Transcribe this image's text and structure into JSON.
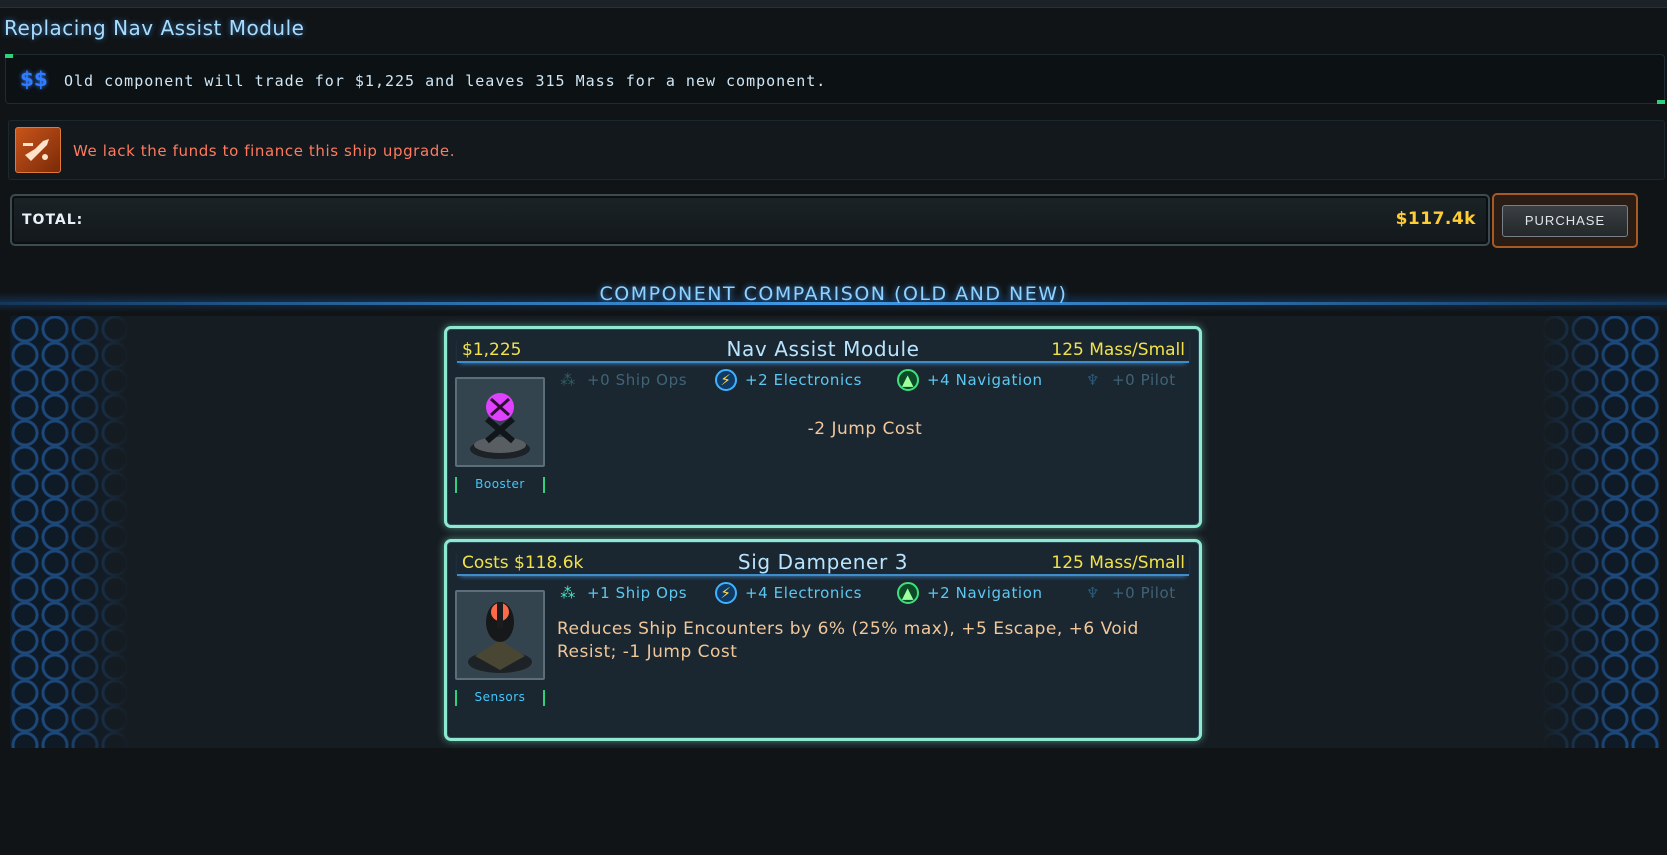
{
  "page_title": "Replacing Nav Assist Module",
  "trade": {
    "icon": "$$",
    "text": "Old component will trade for $1,225 and leaves 315 Mass for a new component."
  },
  "warning": {
    "icon": "ship-wrench-icon",
    "text": "We lack the funds to finance this ship upgrade."
  },
  "total": {
    "label": "TOTAL:",
    "value": "$117.4k"
  },
  "purchase_label": "PURCHASE",
  "section_title": "COMPONENT COMPARISON (OLD AND NEW)",
  "old_component": {
    "cost": "$1,225",
    "name": "Nav Assist Module",
    "mass": "125 Mass/Small",
    "stats": {
      "ship_ops": "+0 Ship Ops",
      "electronics": "+2 Electronics",
      "navigation": "+4 Navigation",
      "pilot": "+0 Pilot"
    },
    "type_label": "Booster",
    "description": "-2 Jump Cost"
  },
  "new_component": {
    "cost": "Costs $118.6k",
    "name": "Sig Dampener 3",
    "mass": "125 Mass/Small",
    "stats": {
      "ship_ops": "+1 Ship Ops",
      "electronics": "+4 Electronics",
      "navigation": "+2 Navigation",
      "pilot": "+0 Pilot"
    },
    "type_label": "Sensors",
    "description": "Reduces Ship Encounters by 6% (25% max), +5 Escape, +6 Void Resist; -1 Jump Cost"
  },
  "colors": {
    "accent_blue": "#8fd2ff",
    "cost_yellow": "#f2e24a",
    "warning_red": "#ff7a5e",
    "total_gold": "#ffcc33",
    "card_border": "#8fe8d0"
  }
}
